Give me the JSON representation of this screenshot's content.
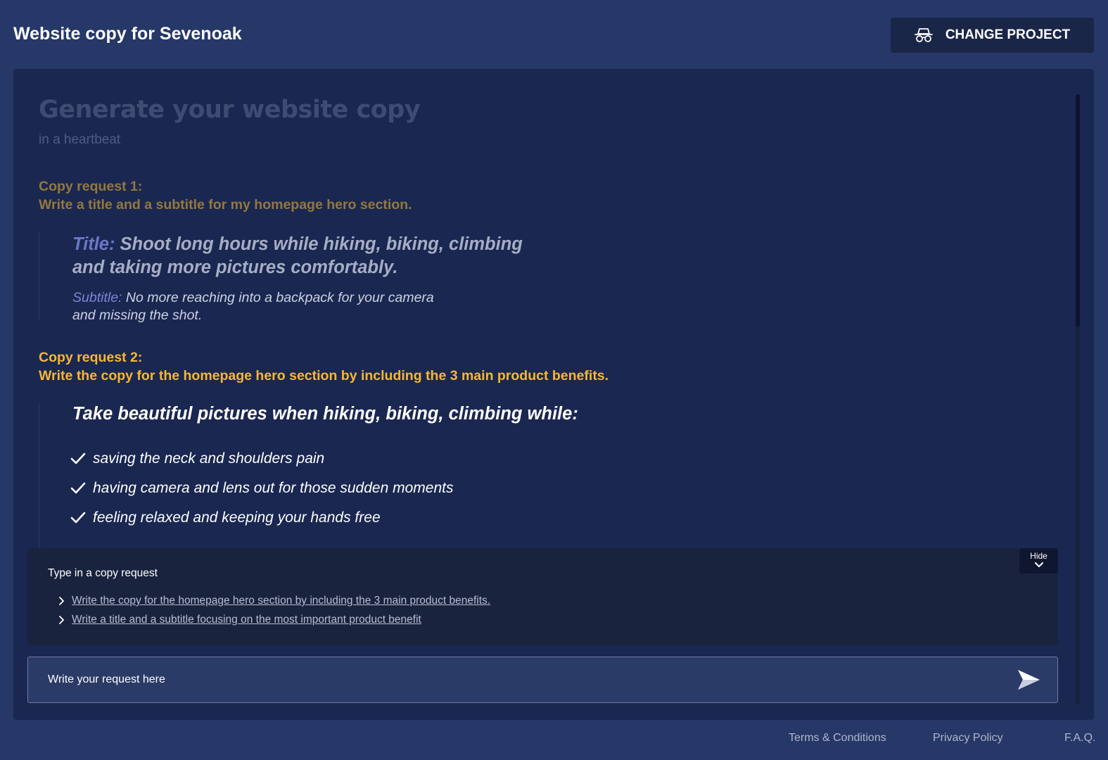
{
  "header": {
    "title": "Website copy for Sevenoak",
    "change_project_label": "CHANGE PROJECT",
    "change_project_icon": "spy-glasses-icon"
  },
  "main": {
    "heading": "Generate your website copy",
    "subheading": "in a heartbeat",
    "requests": [
      {
        "label": "Copy request 1:",
        "text": "Write a title and a subtitle for my homepage hero section.",
        "answer": {
          "title_label": "Title:",
          "title_line1": " Shoot long hours while hiking, biking, climbing",
          "title_line2": "and taking more pictures comfortably.",
          "subtitle_label": "Subtitle:",
          "subtitle_line1": " No more reaching into a backpack for your camera",
          "subtitle_line2": "and missing the shot."
        }
      },
      {
        "label": "Copy request 2:",
        "text": "Write the copy for the homepage hero section by including the 3 main product benefits.",
        "answer": {
          "headline": "Take beautiful pictures when hiking, biking, climbing while:",
          "benefits": [
            "saving the neck and shoulders pain",
            "having camera and lens out for those sudden moments",
            "feeling relaxed and keeping your hands free"
          ]
        }
      }
    ]
  },
  "suggestions": {
    "label": "Type in a copy request",
    "hide_label": "Hide",
    "items": [
      "Write the copy for the homepage hero section by including the 3 main product benefits.",
      "Write a title and a subtitle focusing on the most important product benefit"
    ]
  },
  "input": {
    "placeholder": "Write your request here",
    "send_icon": "send-icon"
  },
  "footer": {
    "terms": "Terms & Conditions",
    "privacy": "Privacy Policy",
    "faq": "F.A.Q."
  },
  "colors": {
    "background": "#263868",
    "panel": "#1a2751",
    "request_active": "#f7b733",
    "request_faded": "#94783c",
    "label_accent": "#6a78c8"
  }
}
